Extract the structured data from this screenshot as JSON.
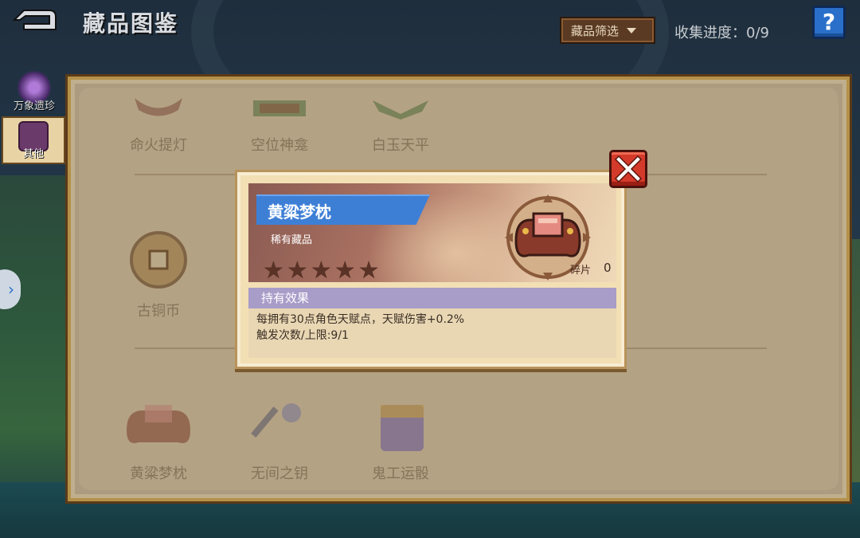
{
  "header": {
    "title": "藏品图鉴",
    "filter_label": "藏品筛选",
    "progress": "收集进度：0/9",
    "help_label": "?"
  },
  "sidebar": {
    "tabs": [
      {
        "label": "万象遗珍",
        "icon": "gem-icon"
      },
      {
        "label": "其他",
        "icon": "relic-icon"
      }
    ]
  },
  "collection": {
    "row1": [
      "命火提灯",
      "空位神龛",
      "白玉天平"
    ],
    "row2": [
      "古铜币"
    ],
    "row3": [
      "黄粱梦枕",
      "无间之钥",
      "鬼工运骰"
    ]
  },
  "popup": {
    "name": "黄粱梦枕",
    "rarity": "稀有藏品",
    "stars": 5,
    "fragment_label": "碎片",
    "fragment_count": "0",
    "effect_header": "持有效果",
    "effect_line1": "每拥有30点角色天赋点，天赋伤害+0.2%",
    "effect_line2": "触发次数/上限:9/1"
  },
  "colors": {
    "name_tag": "#3e7fd6",
    "close_button": "#d43a2a",
    "effect_header": "#a89cc8",
    "panel": "#beae91"
  }
}
